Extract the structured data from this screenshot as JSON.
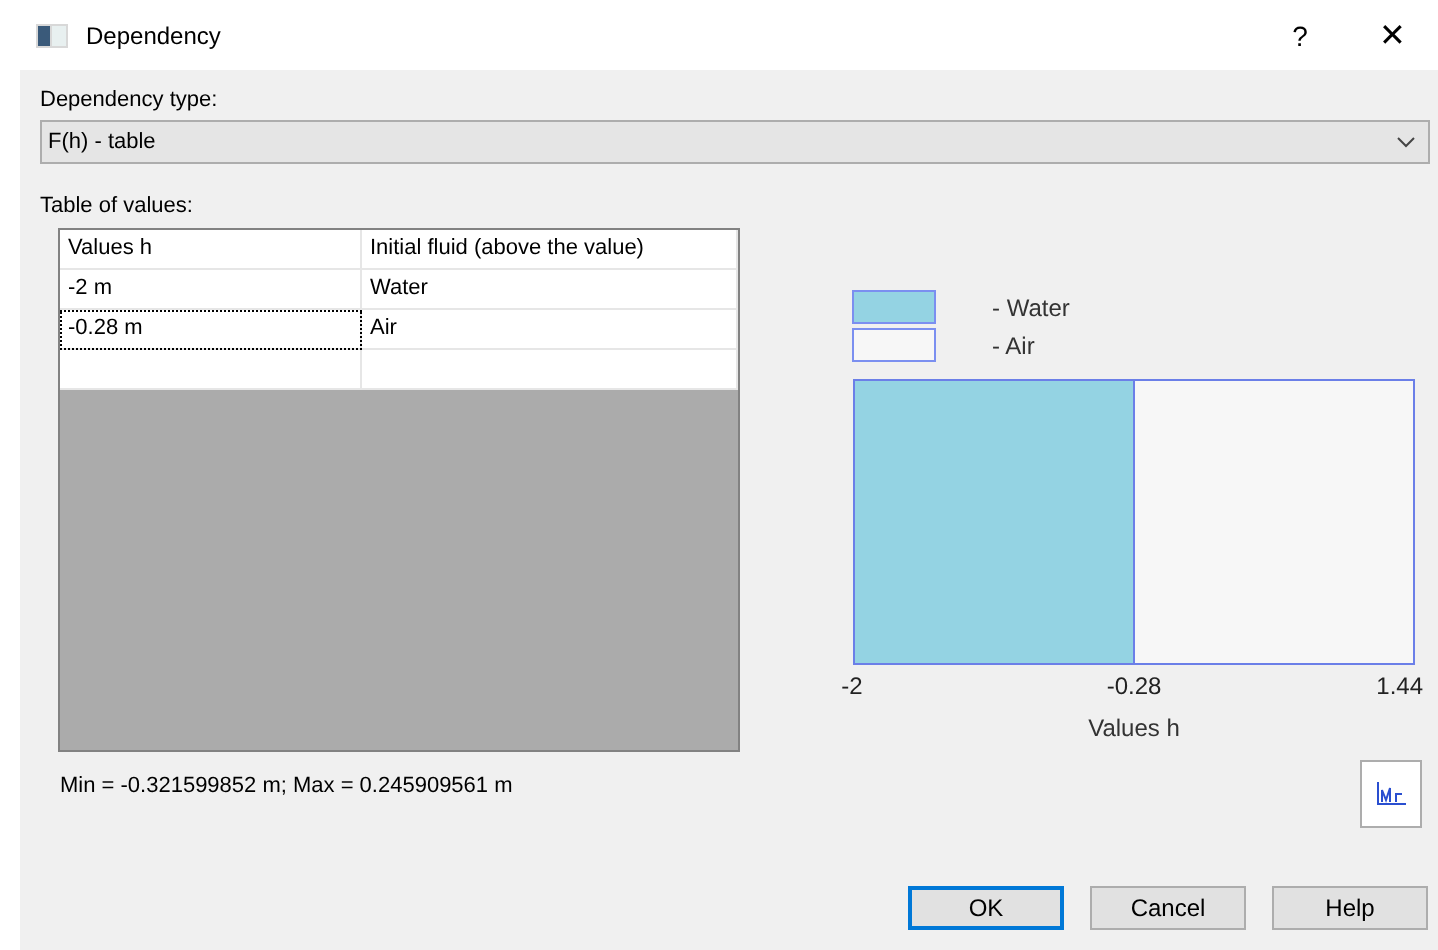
{
  "window": {
    "title": "Dependency",
    "help": "?",
    "close": "✕"
  },
  "dependency_type": {
    "label": "Dependency type:",
    "value": "F(h) - table"
  },
  "table": {
    "label": "Table of values:",
    "columns": [
      "Values h",
      "Initial fluid (above the value)"
    ],
    "rows": [
      {
        "cells": [
          "-2 m",
          "Water"
        ],
        "selected": false
      },
      {
        "cells": [
          "-0.28 m",
          "Air"
        ],
        "selected": true
      }
    ]
  },
  "range_text": "Min = -0.321599852 m; Max = 0.245909561 m",
  "chart": {
    "legend": [
      {
        "label": "- Water",
        "color": "#94d3e3"
      },
      {
        "label": "- Air",
        "color": "#f7f7f7"
      }
    ],
    "axis_ticks": [
      "-2",
      "-0.28",
      "1.44"
    ],
    "axis_label": "Values h"
  },
  "buttons": [
    {
      "label": "OK",
      "default": true
    },
    {
      "label": "Cancel",
      "default": false
    },
    {
      "label": "Help",
      "default": false
    }
  ]
}
